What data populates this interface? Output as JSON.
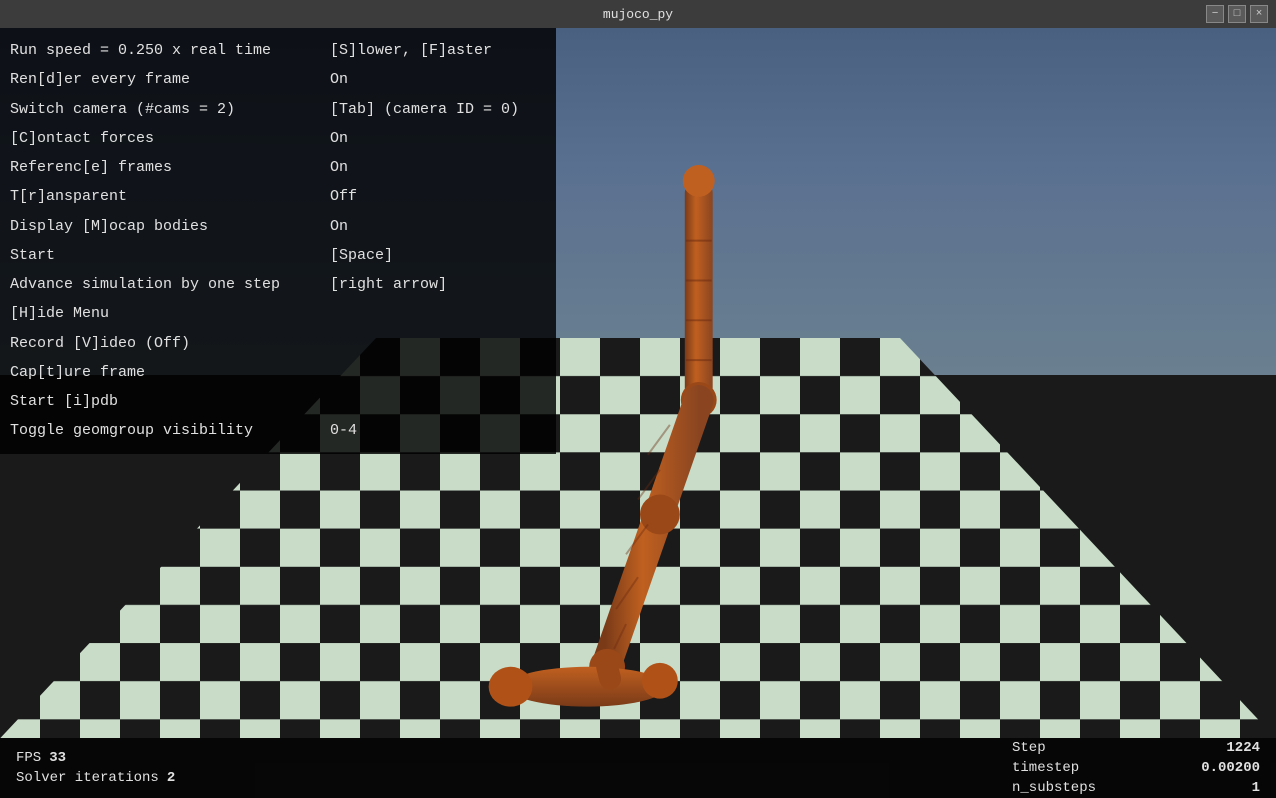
{
  "window": {
    "title": "mujoco_py"
  },
  "titlebar": {
    "buttons": [
      "−",
      "□",
      "×"
    ]
  },
  "menu": {
    "rows": [
      {
        "label": "Run speed = 0.250 x real time",
        "value": "[S]lower, [F]aster"
      },
      {
        "label": "Ren[d]er every frame",
        "value": "On"
      },
      {
        "label": "Switch camera (#cams = 2)",
        "value": "[Tab] (camera ID = 0)"
      },
      {
        "label": "[C]ontact forces",
        "value": "On"
      },
      {
        "label": "Referenc[e] frames",
        "value": "On"
      },
      {
        "label": "T[r]ansparent",
        "value": "Off"
      },
      {
        "label": "Display [M]ocap bodies",
        "value": "On"
      },
      {
        "label": "Start",
        "value": "[Space]"
      },
      {
        "label": "Advance simulation by one step",
        "value": "[right arrow]"
      },
      {
        "label": "[H]ide Menu",
        "value": ""
      },
      {
        "label": "Record [V]ideo (Off)",
        "value": ""
      },
      {
        "label": "Cap[t]ure frame",
        "value": ""
      },
      {
        "label": "Start [i]pdb",
        "value": ""
      },
      {
        "label": "Toggle geomgroup visibility",
        "value": "0-4"
      }
    ]
  },
  "status": {
    "fps_label": "FPS",
    "fps_value": "33",
    "solver_label": "Solver iterations",
    "solver_value": "2",
    "step_label": "Step",
    "step_value": "1224",
    "timestep_label": "timestep",
    "timestep_value": "0.00200",
    "nsubsteps_label": "n_substeps",
    "nsubsteps_value": "1"
  }
}
